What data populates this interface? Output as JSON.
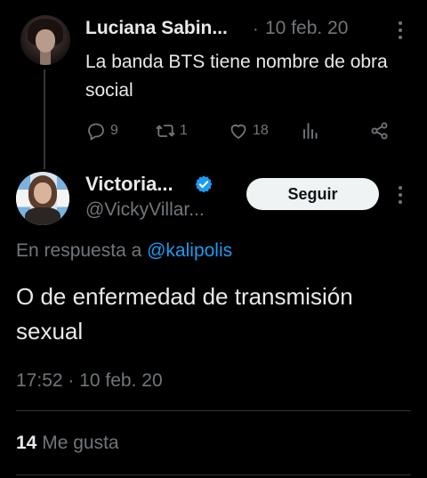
{
  "parent_tweet": {
    "author_name": "Luciana Sabin...",
    "separator": "·",
    "date": "10 feb. 20",
    "text": "La banda BTS tiene nombre de obra social",
    "actions": {
      "reply_count": "9",
      "retweet_count": "1",
      "like_count": "18",
      "reply_icon": "reply-icon",
      "retweet_icon": "retweet-icon",
      "like_icon": "heart-icon",
      "views_icon": "views-icon",
      "share_icon": "share-icon"
    }
  },
  "main_tweet": {
    "author_name": "Victoria...",
    "verified_icon": "verified-badge-icon",
    "handle": "@VickyVillar...",
    "follow_label": "Seguir",
    "reply_prefix": "En respuesta a",
    "reply_mention": "@kalipolis",
    "text": "O de enfermedad de transmisión sexual",
    "timestamp": "17:52 · 10 feb. 20",
    "likes_count": "14",
    "likes_label": "Me gusta"
  },
  "colors": {
    "background": "#000000",
    "text_primary": "#e7e9ea",
    "text_secondary": "#71767b",
    "accent": "#1d9bf0",
    "button_bg": "#eff3f4"
  }
}
